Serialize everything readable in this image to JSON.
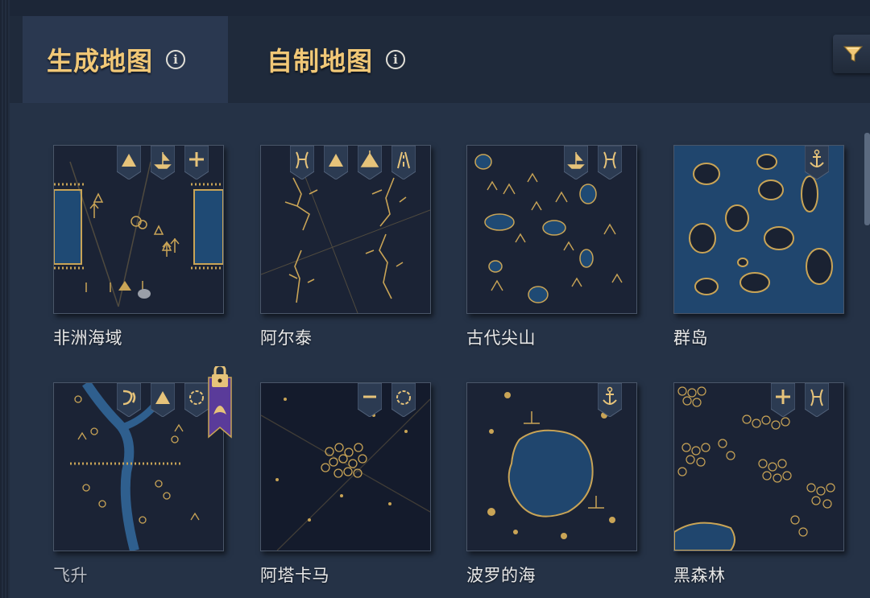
{
  "tabs": [
    {
      "label": "生成地图",
      "active": true
    },
    {
      "label": "自制地图",
      "active": false
    }
  ],
  "info_icon_glyph": "i",
  "filter_icon": "funnel-icon",
  "colors": {
    "accent": "#f1c877",
    "gold": "#c9a456",
    "panel": "#253246",
    "card": "#1a2232"
  },
  "maps": [
    {
      "name": "非洲海域",
      "badges": [
        "mountain-icon",
        "shipwreck-icon",
        "plus-icon"
      ],
      "locked": false
    },
    {
      "name": "阿尔泰",
      "badges": [
        "pass-icon",
        "mountain-icon",
        "tent-icon",
        "path-icon"
      ],
      "locked": false
    },
    {
      "name": "古代尖山",
      "badges": [
        "shipwreck-icon",
        "pass-icon"
      ],
      "locked": false
    },
    {
      "name": "群岛",
      "badges": [
        "anchor-icon"
      ],
      "locked": false
    },
    {
      "name": "飞升",
      "badges": [
        "swirl-icon",
        "mountain-icon",
        "circle-icon"
      ],
      "locked": true
    },
    {
      "name": "阿塔卡马",
      "badges": [
        "minus-icon",
        "circle-icon"
      ],
      "locked": false
    },
    {
      "name": "波罗的海",
      "badges": [
        "anchor-icon"
      ],
      "locked": false
    },
    {
      "name": "黑森林",
      "badges": [
        "plus-icon",
        "pass-icon"
      ],
      "locked": false
    }
  ]
}
